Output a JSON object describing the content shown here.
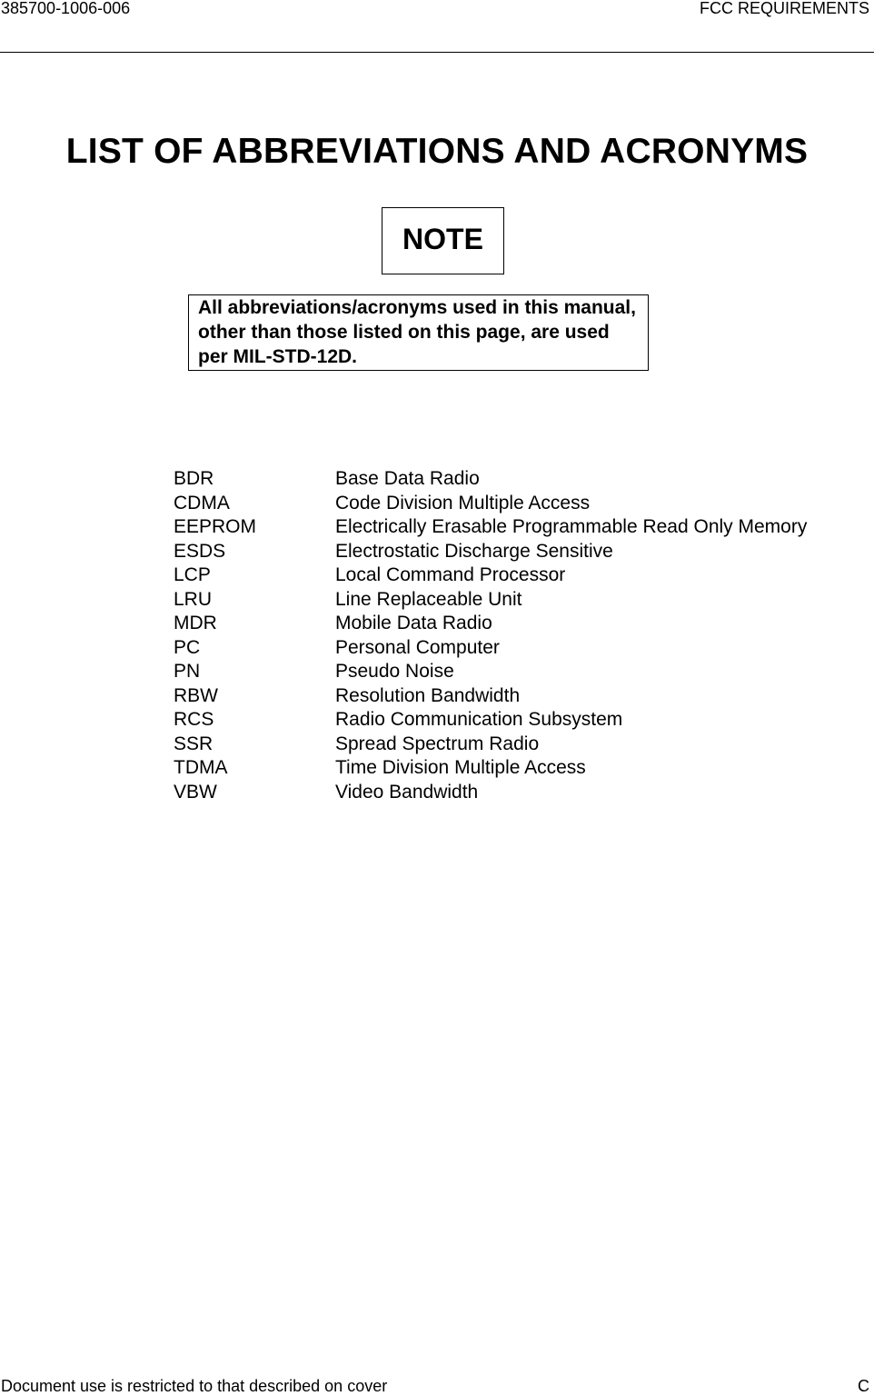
{
  "header": {
    "doc_number": "385700-1006-006",
    "section": "FCC REQUIREMENTS"
  },
  "title": "LIST OF ABBREVIATIONS AND ACRONYMS",
  "note": {
    "label": "NOTE",
    "text": "All abbreviations/acronyms used in this manual, other than those listed on this page, are used per MIL-STD-12D."
  },
  "abbreviations": [
    {
      "term": "BDR",
      "definition": "Base Data Radio"
    },
    {
      "term": "CDMA",
      "definition": "Code Division Multiple Access"
    },
    {
      "term": "EEPROM",
      "definition": "Electrically Erasable Programmable Read Only Memory"
    },
    {
      "term": "ESDS",
      "definition": "Electrostatic Discharge Sensitive"
    },
    {
      "term": "LCP",
      "definition": "Local Command Processor"
    },
    {
      "term": "LRU",
      "definition": "Line Replaceable Unit"
    },
    {
      "term": "MDR",
      "definition": "Mobile Data Radio"
    },
    {
      "term": "PC",
      "definition": "Personal Computer"
    },
    {
      "term": "PN",
      "definition": "Pseudo Noise"
    },
    {
      "term": "RBW",
      "definition": "Resolution Bandwidth"
    },
    {
      "term": "RCS",
      "definition": "Radio Communication Subsystem"
    },
    {
      "term": "SSR",
      "definition": "Spread Spectrum Radio"
    },
    {
      "term": "TDMA",
      "definition": "Time Division Multiple Access"
    },
    {
      "term": "VBW",
      "definition": "Video Bandwidth"
    }
  ],
  "footer": {
    "notice": "Document use is restricted to that described on cover",
    "page": "C"
  }
}
